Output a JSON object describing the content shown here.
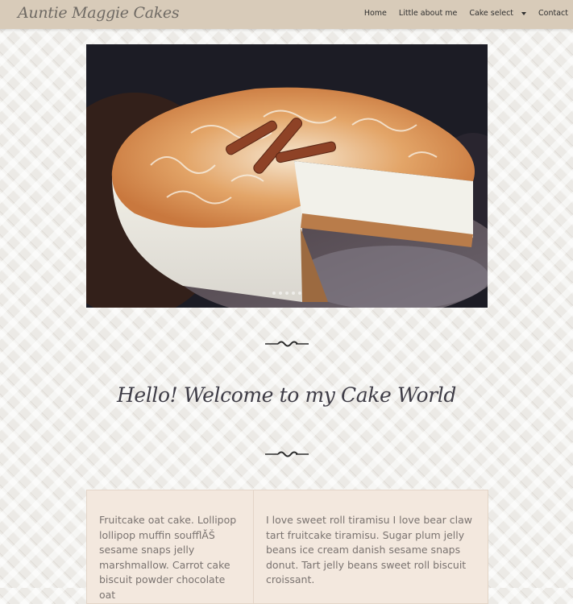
{
  "nav": {
    "brand": "Auntie Maggie Cakes",
    "items": [
      "Home",
      "Little about me",
      "Cake select",
      "Contact"
    ]
  },
  "carousel": {
    "image_desc": "cake-photo",
    "indicator_count": 6
  },
  "heading": "Hello! Welcome to my Cake World",
  "cards": [
    {
      "text": "Fruitcake oat cake. Lollipop lollipop muffin soufflĂŠ sesame snaps jelly marshmallow. Carrot cake biscuit powder chocolate oat"
    },
    {
      "text": "I love sweet roll tiramisu I love bear claw tart fruitcake tiramisu. Sugar plum jelly beans ice cream danish sesame snaps donut. Tart jelly beans sweet roll biscuit croissant."
    }
  ],
  "colors": {
    "navbar": "#d8cbb9",
    "card": "#f3e8de",
    "heading": "#3e3c46"
  }
}
